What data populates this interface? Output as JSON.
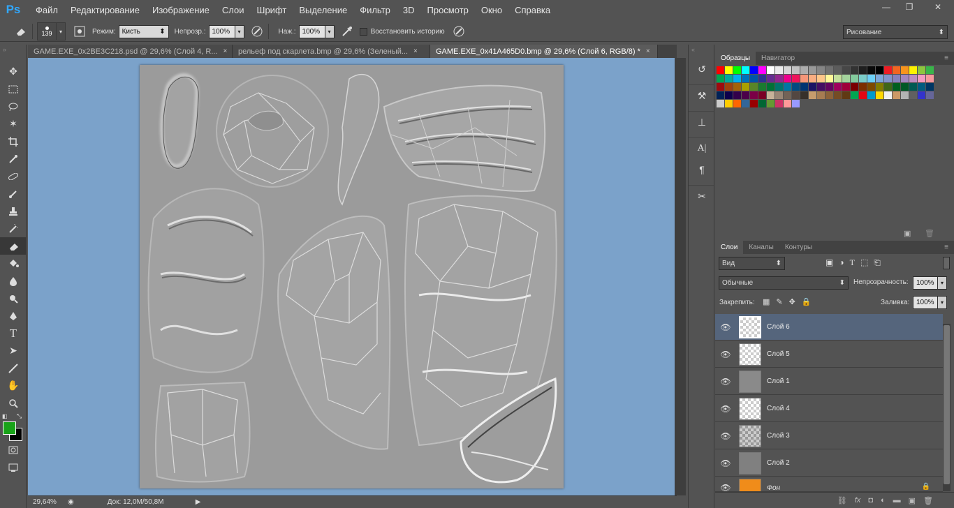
{
  "app": {
    "logo": "Ps"
  },
  "menu": [
    "Файл",
    "Редактирование",
    "Изображение",
    "Слои",
    "Шрифт",
    "Выделение",
    "Фильтр",
    "3D",
    "Просмотр",
    "Окно",
    "Справка"
  ],
  "window": {
    "minimize": "—",
    "restore": "❐",
    "close": "✕"
  },
  "options": {
    "brush_size": "139",
    "mode_label": "Режим:",
    "mode_value": "Кисть",
    "opacity_label": "Непрозр.:",
    "opacity_value": "100%",
    "pressure_label": "Наж.:",
    "pressure_value": "100%",
    "restore_history": "Восстановить историю",
    "workspace": "Рисование"
  },
  "tabs": [
    {
      "label": "GAME.EXE_0x2BE3C218.psd @ 29,6% (Слой 4, R...",
      "close": "×"
    },
    {
      "label": "рельеф под скарлета.bmp @ 29,6% (Зеленый...",
      "close": "×"
    },
    {
      "label": "GAME.EXE_0x41A465D0.bmp @ 29,6% (Слой 6, RGB/8) *",
      "close": "×"
    }
  ],
  "status": {
    "zoom": "29,64%",
    "doc": "Док: 12,0M/50,8M"
  },
  "swatches_panel": {
    "tab1": "Образцы",
    "tab2": "Навигатор"
  },
  "layers_panel": {
    "tab1": "Слои",
    "tab2": "Каналы",
    "tab3": "Контуры",
    "filter_kind": "Вид",
    "blend_mode": "Обычные",
    "opacity_label": "Непрозрачность:",
    "opacity_value": "100%",
    "lock_label": "Закрепить:",
    "fill_label": "Заливка:",
    "fill_value": "100%"
  },
  "layers": [
    {
      "name": "Слой 6"
    },
    {
      "name": "Слой 5"
    },
    {
      "name": "Слой 1"
    },
    {
      "name": "Слой 4"
    },
    {
      "name": "Слой 3"
    },
    {
      "name": "Слой 2"
    },
    {
      "name": "Фон"
    }
  ],
  "colors": {
    "foreground": "#19a319",
    "background": "#000000",
    "canvas_bg": "#7ba2ca"
  }
}
